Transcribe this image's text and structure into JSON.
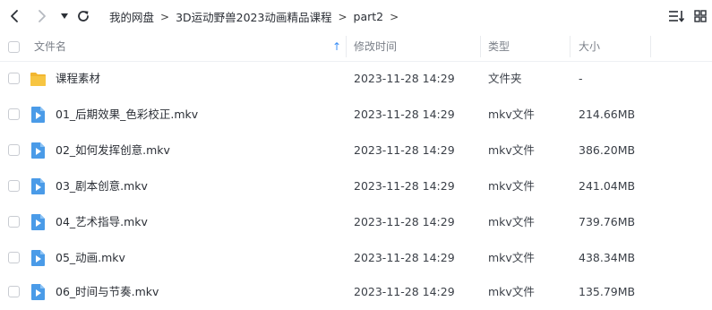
{
  "toolbar": {
    "back_icon": "chevron-left-icon",
    "forward_icon": "chevron-right-icon",
    "dropdown_icon": "caret-down-icon",
    "refresh_icon": "refresh-icon",
    "sort_icon": "sort-list-icon",
    "grid_icon": "grid-view-icon"
  },
  "breadcrumb": {
    "items": [
      "我的网盘",
      "3D运动野兽2023动画精品课程",
      "part2"
    ],
    "separator": ">"
  },
  "header": {
    "name": "文件名",
    "modified": "修改时间",
    "type": "类型",
    "size": "大小",
    "sort_indicator": "↑"
  },
  "colors": {
    "accent": "#3a8ef6",
    "folder": "#f7c542",
    "video": "#4a9be8"
  },
  "files": [
    {
      "name": "课程素材",
      "modified": "2023-11-28 14:29",
      "type": "文件夹",
      "size": "-",
      "icon": "folder-icon"
    },
    {
      "name": "01_后期效果_色彩校正.mkv",
      "modified": "2023-11-28 14:29",
      "type": "mkv文件",
      "size": "214.66MB",
      "icon": "video-file-icon"
    },
    {
      "name": "02_如何发挥创意.mkv",
      "modified": "2023-11-28 14:29",
      "type": "mkv文件",
      "size": "386.20MB",
      "icon": "video-file-icon"
    },
    {
      "name": "03_剧本创意.mkv",
      "modified": "2023-11-28 14:29",
      "type": "mkv文件",
      "size": "241.04MB",
      "icon": "video-file-icon"
    },
    {
      "name": "04_艺术指导.mkv",
      "modified": "2023-11-28 14:29",
      "type": "mkv文件",
      "size": "739.76MB",
      "icon": "video-file-icon"
    },
    {
      "name": "05_动画.mkv",
      "modified": "2023-11-28 14:29",
      "type": "mkv文件",
      "size": "438.34MB",
      "icon": "video-file-icon"
    },
    {
      "name": "06_时间与节奏.mkv",
      "modified": "2023-11-28 14:29",
      "type": "mkv文件",
      "size": "135.79MB",
      "icon": "video-file-icon"
    }
  ]
}
